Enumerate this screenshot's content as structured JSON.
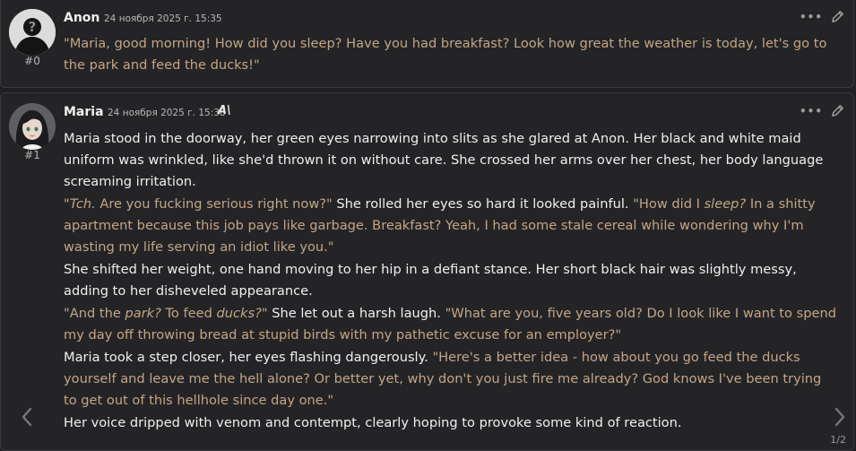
{
  "messages": [
    {
      "name": "Anon",
      "date": "24 ноября 2025 г. 15:35",
      "index": "#0",
      "segments": [
        {
          "t": "q",
          "text": "\"Maria, good morning! How did you sleep? Have you had breakfast? Look how great the weather is today, let's go to the park and feed the ducks!\""
        }
      ]
    },
    {
      "name": "Maria",
      "date": "24 ноября 2025 г. 15:38",
      "index": "#1",
      "model_badge": "A\\",
      "paragraphs": [
        [
          {
            "t": "w",
            "text": "Maria stood in the doorway, her green eyes narrowing into slits as she glared at Anon. Her black and white maid uniform was wrinkled, like she'd thrown it on without care. She crossed her arms over her chest, her body language screaming irritation."
          }
        ],
        [
          {
            "t": "q",
            "text": "\""
          },
          {
            "t": "qi",
            "text": "Tch."
          },
          {
            "t": "q",
            "text": " Are you fucking serious right now?\" "
          },
          {
            "t": "w",
            "text": "She rolled her eyes so hard it looked painful. "
          },
          {
            "t": "q",
            "text": "\"How did I "
          },
          {
            "t": "qi",
            "text": "sleep?"
          },
          {
            "t": "q",
            "text": " In a shitty apartment because this job pays like garbage. Breakfast? Yeah, I had some stale cereal while wondering why I'm wasting my life serving an idiot like you.\""
          }
        ],
        [
          {
            "t": "w",
            "text": "She shifted her weight, one hand moving to her hip in a defiant stance. Her short black hair was slightly messy, adding to her disheveled appearance."
          }
        ],
        [
          {
            "t": "q",
            "text": "\"And the "
          },
          {
            "t": "qi",
            "text": "park?"
          },
          {
            "t": "q",
            "text": " To feed "
          },
          {
            "t": "qi",
            "text": "ducks?"
          },
          {
            "t": "q",
            "text": "\" "
          },
          {
            "t": "w",
            "text": "She let out a harsh laugh. "
          },
          {
            "t": "q",
            "text": "\"What are you, five years old? Do I look like I want to spend my day off throwing bread at stupid birds with my pathetic excuse for an employer?\""
          }
        ],
        [
          {
            "t": "w",
            "text": "Maria took a step closer, her eyes flashing dangerously. "
          },
          {
            "t": "q",
            "text": "\"Here's a better idea - how about you go feed the ducks yourself and leave me the hell alone? Or better yet, why don't you just fire me already? God knows I've been trying to get out of this hellhole since day one.\""
          }
        ],
        [
          {
            "t": "w",
            "text": "Her voice dripped with venom and contempt, clearly hoping to provoke some kind of reaction."
          }
        ]
      ],
      "pager": "1/2"
    }
  ],
  "icons": {
    "more": "more-icon",
    "edit": "pencil-icon",
    "prev": "chevron-left-icon",
    "next": "chevron-right-icon"
  },
  "colors": {
    "background": "#202022",
    "card": "#242427",
    "quote": "#c4a584",
    "narration": "#efefef"
  }
}
